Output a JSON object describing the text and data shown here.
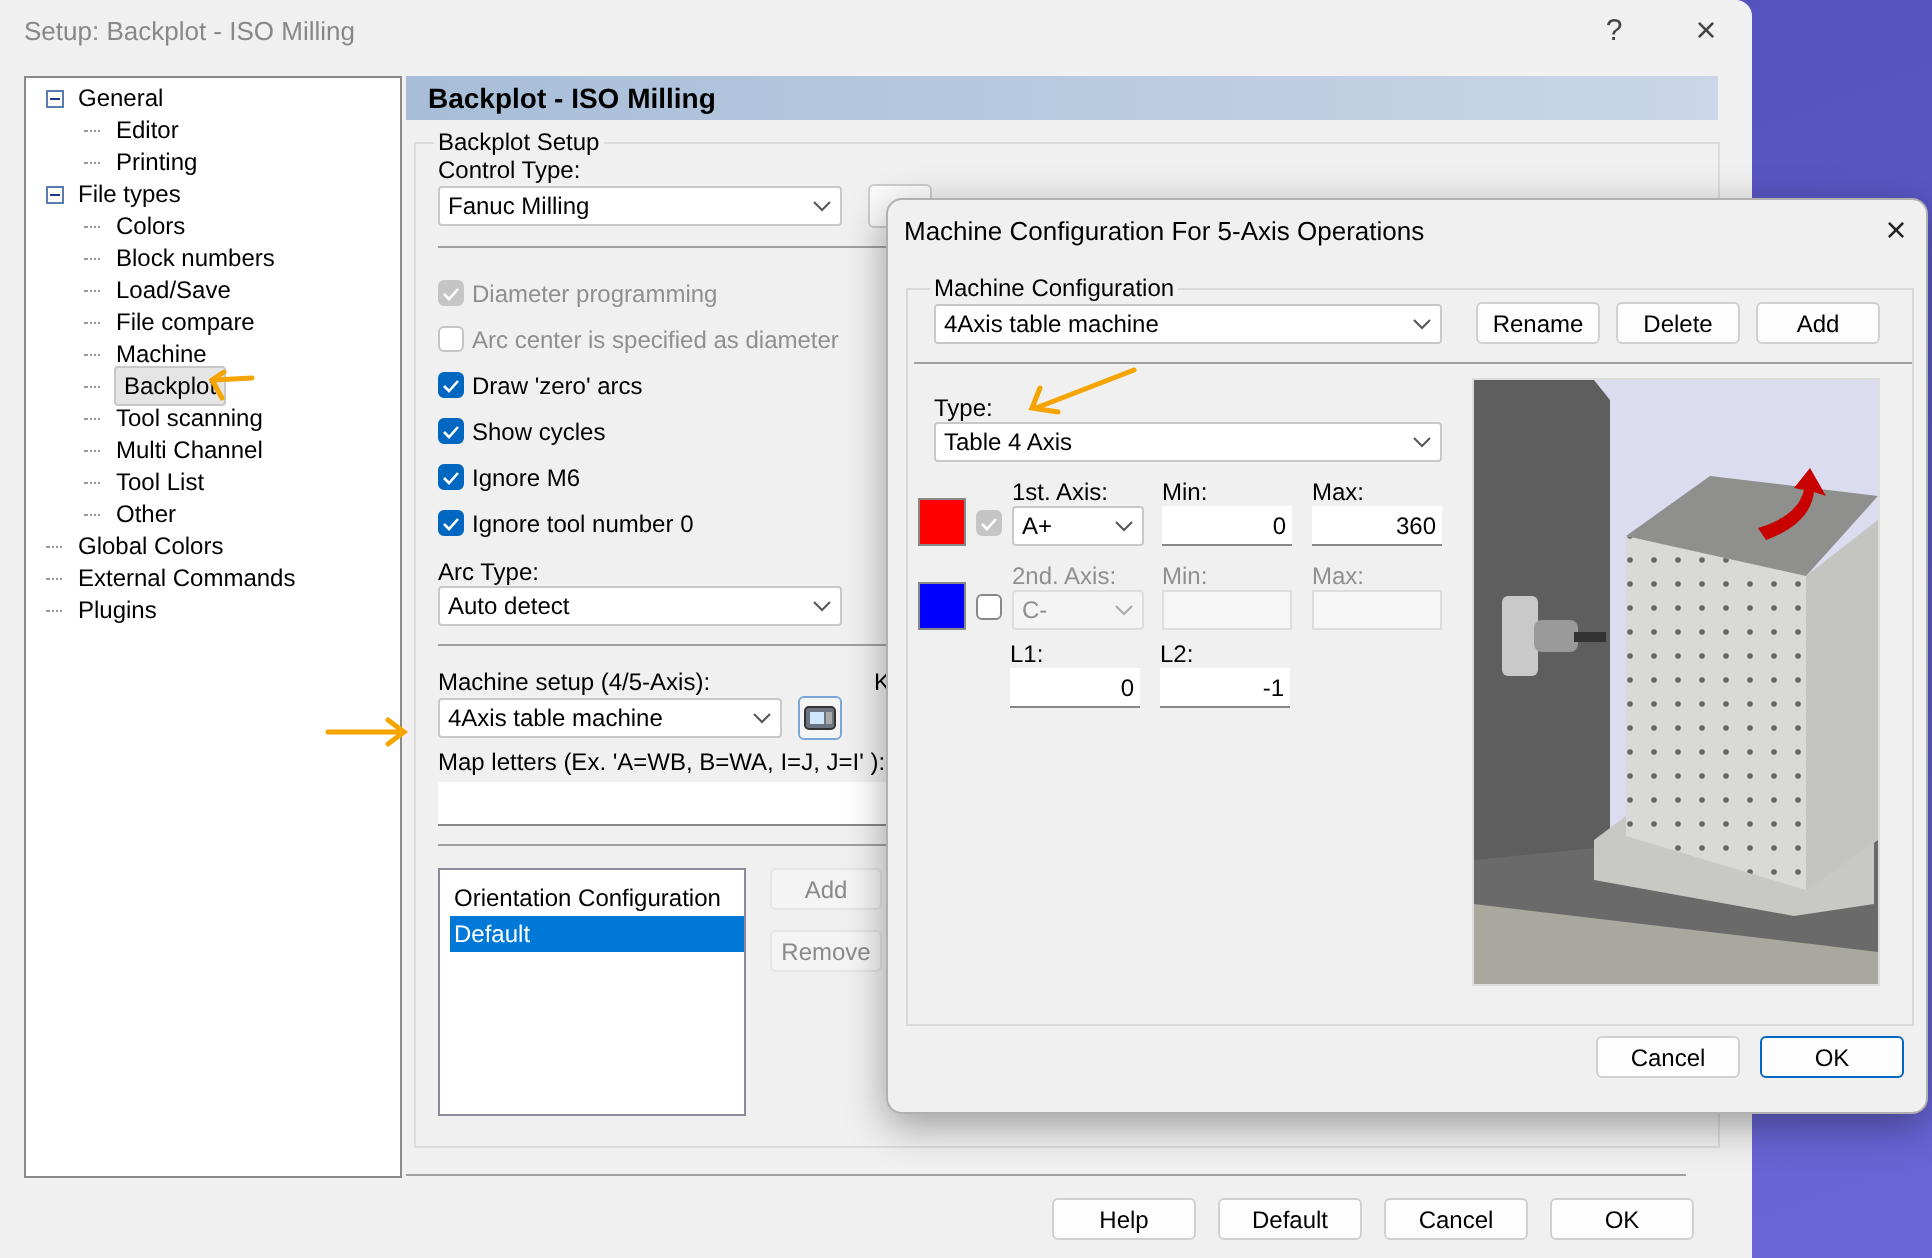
{
  "window": {
    "title": "Setup: Backplot - ISO Milling",
    "help": "?",
    "close": "×"
  },
  "tree": [
    {
      "label": "General",
      "expanded": true,
      "selected": false,
      "children": [
        {
          "label": "Editor",
          "selected": false
        },
        {
          "label": "Printing",
          "selected": false
        }
      ]
    },
    {
      "label": "File types",
      "expanded": true,
      "selected": false,
      "children": [
        {
          "label": "Colors",
          "selected": false
        },
        {
          "label": "Block numbers",
          "selected": false
        },
        {
          "label": "Load/Save",
          "selected": false
        },
        {
          "label": "File compare",
          "selected": false
        },
        {
          "label": "Machine",
          "selected": false
        },
        {
          "label": "Backplot",
          "selected": true
        },
        {
          "label": "Tool scanning",
          "selected": false
        },
        {
          "label": "Multi Channel",
          "selected": false
        },
        {
          "label": "Tool List",
          "selected": false
        },
        {
          "label": "Other",
          "selected": false
        }
      ]
    },
    {
      "label": "Global Colors",
      "selected": false
    },
    {
      "label": "External Commands",
      "selected": false
    },
    {
      "label": "Plugins",
      "selected": false
    }
  ],
  "panel": {
    "title": "Backplot - ISO Milling",
    "group": "Backplot Setup",
    "control_type": {
      "label": "Control Type:",
      "value": "Fanuc Milling"
    },
    "options": [
      {
        "label": "Diameter programming",
        "checked": true,
        "disabled": true
      },
      {
        "label": "Arc center is specified as diameter",
        "checked": false,
        "disabled": true
      },
      {
        "label": "Draw 'zero' arcs",
        "checked": true,
        "disabled": false
      },
      {
        "label": "Show cycles",
        "checked": true,
        "disabled": false
      },
      {
        "label": "Ignore M6",
        "checked": true,
        "disabled": false
      },
      {
        "label": "Ignore tool number 0",
        "checked": true,
        "disabled": false
      }
    ],
    "arc_type": {
      "label": "Arc Type:",
      "value": "Auto detect"
    },
    "machine_setup": {
      "label": "Machine setup (4/5-Axis):",
      "value": "4Axis table machine"
    },
    "cut_label": "K",
    "map_letters": {
      "label": "Map letters (Ex. 'A=WB, B=WA, I=J, J=I' ):"
    },
    "orientation": {
      "header": "Orientation Configuration",
      "items": [
        {
          "label": "Default",
          "selected": true
        }
      ]
    },
    "side_buttons": [
      {
        "label": "Add",
        "disabled": true
      },
      {
        "label": "Remove",
        "disabled": true
      }
    ]
  },
  "footer_buttons": [
    "Help",
    "Default",
    "Cancel",
    "OK"
  ],
  "dialog": {
    "title": "Machine Configuration For 5-Axis Operations",
    "close": "×",
    "group": "Machine Configuration",
    "machine": "4Axis table machine",
    "buttons": [
      "Rename",
      "Delete",
      "Add"
    ],
    "type": {
      "label": "Type:",
      "value": "Table 4 Axis"
    },
    "axes": [
      {
        "color": "#ff0000",
        "checked": true,
        "check_disabled": true,
        "disabled": false,
        "axis_label": "1st. Axis:",
        "axis": "A+",
        "min_label": "Min:",
        "min": "0",
        "max_label": "Max:",
        "max": "360"
      },
      {
        "color": "#0000ff",
        "checked": false,
        "check_disabled": false,
        "disabled": true,
        "axis_label": "2nd. Axis:",
        "axis": "C-",
        "min_label": "Min:",
        "max_label": "Max:"
      }
    ],
    "lengths": [
      {
        "label": "L1:",
        "value": "0"
      },
      {
        "label": "L2:",
        "value": "-1"
      }
    ],
    "footer": [
      {
        "label": "Cancel",
        "default": false
      },
      {
        "label": "OK",
        "default": true
      }
    ]
  }
}
